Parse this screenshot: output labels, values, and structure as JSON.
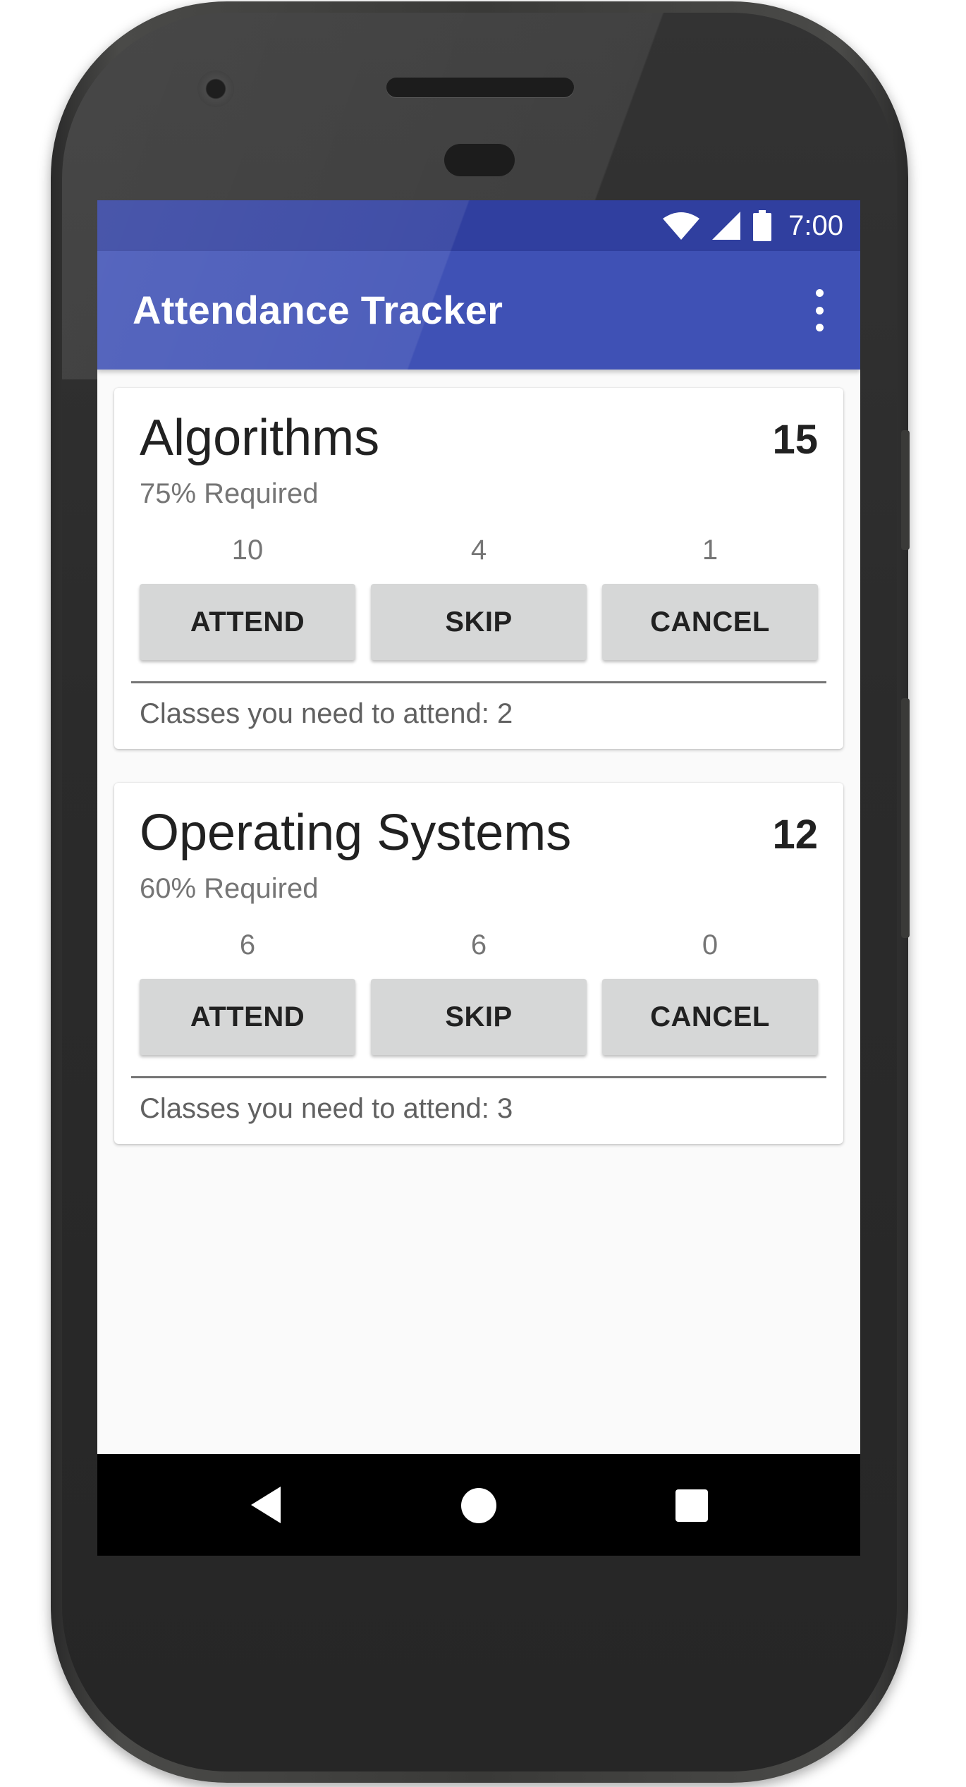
{
  "status_bar": {
    "time": "7:00",
    "icons": [
      "wifi-icon",
      "signal-icon",
      "battery-icon"
    ]
  },
  "app_bar": {
    "title": "Attendance Tracker",
    "menu_icon": "overflow-menu-icon"
  },
  "courses": [
    {
      "name": "Algorithms",
      "total": "15",
      "required": "75% Required",
      "attended": "10",
      "skipped": "4",
      "cancelled": "1",
      "attend_label": "ATTEND",
      "skip_label": "SKIP",
      "cancel_label": "CANCEL",
      "need_text": "Classes you need to attend: 2"
    },
    {
      "name": "Operating Systems",
      "total": "12",
      "required": "60% Required",
      "attended": "6",
      "skipped": "6",
      "cancelled": "0",
      "attend_label": "ATTEND",
      "skip_label": "SKIP",
      "cancel_label": "CANCEL",
      "need_text": "Classes you need to attend: 3"
    }
  ],
  "nav_bar": {
    "icons": [
      "back-icon",
      "home-icon",
      "recents-icon"
    ]
  },
  "colors": {
    "primary": "#3f51b5",
    "primary_dark": "#303f9f",
    "button_bg": "#d6d7d7",
    "background": "#fafafa"
  }
}
